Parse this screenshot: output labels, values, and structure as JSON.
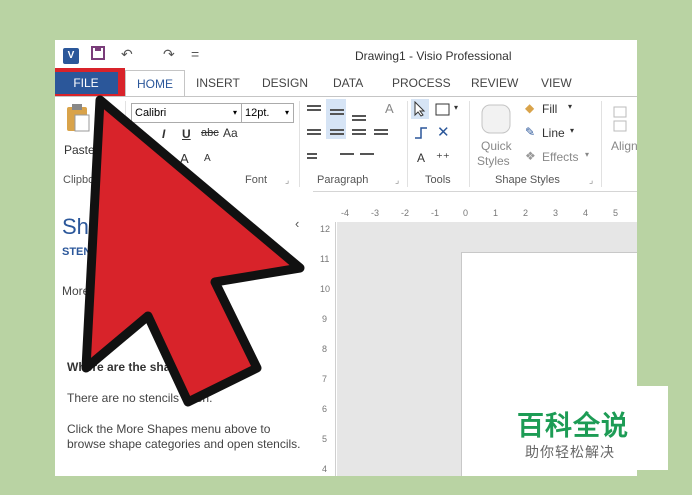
{
  "window": {
    "title": "Drawing1 - Visio Professional",
    "app_badge": "V"
  },
  "qat": {
    "undo": "↶",
    "redo": "↷",
    "more": "="
  },
  "tabs": {
    "file": "FILE",
    "items": [
      "HOME",
      "INSERT",
      "DESIGN",
      "DATA",
      "PROCESS",
      "REVIEW",
      "VIEW"
    ]
  },
  "ribbon": {
    "clipboard": {
      "paste": "Paste",
      "label": "Clipboard"
    },
    "font": {
      "family": "Calibri",
      "size": "12pt.",
      "italic": "I",
      "underline": "U",
      "strike": "abc",
      "case": "Aa",
      "grow": "A",
      "shrink": "A",
      "label": "Font"
    },
    "paragraph": {
      "label": "Paragraph"
    },
    "tools": {
      "label": "Tools",
      "text": "A"
    },
    "shape_styles": {
      "quick": "Quick",
      "styles": "Styles",
      "fill": "Fill",
      "line": "Line",
      "effects": "Effects",
      "label": "Shape Styles"
    },
    "arrange": {
      "align": "Align"
    }
  },
  "pane": {
    "title": "Shap",
    "stencils": "STENCILS",
    "more_shapes": "More Sha",
    "question": "Where are the shapes?",
    "no_stencils": "There are no stencils open.",
    "hint": "Click the More Shapes menu above to browse shape categories and open stencils.",
    "collapse": "‹"
  },
  "ruler": {
    "h_ticks": [
      "-4",
      "-3",
      "-2",
      "-1",
      "0",
      "1",
      "2",
      "3",
      "4",
      "5"
    ],
    "v_ticks": [
      "12",
      "11",
      "10",
      "9",
      "8",
      "7",
      "6",
      "5",
      "4"
    ]
  },
  "watermark": {
    "main": "百科全说",
    "sub": "助你轻松解决"
  },
  "colors": {
    "accent": "#2b579a",
    "highlight": "#d8232a",
    "background": "#b9d3a3",
    "watermark": "#1d9c55"
  }
}
